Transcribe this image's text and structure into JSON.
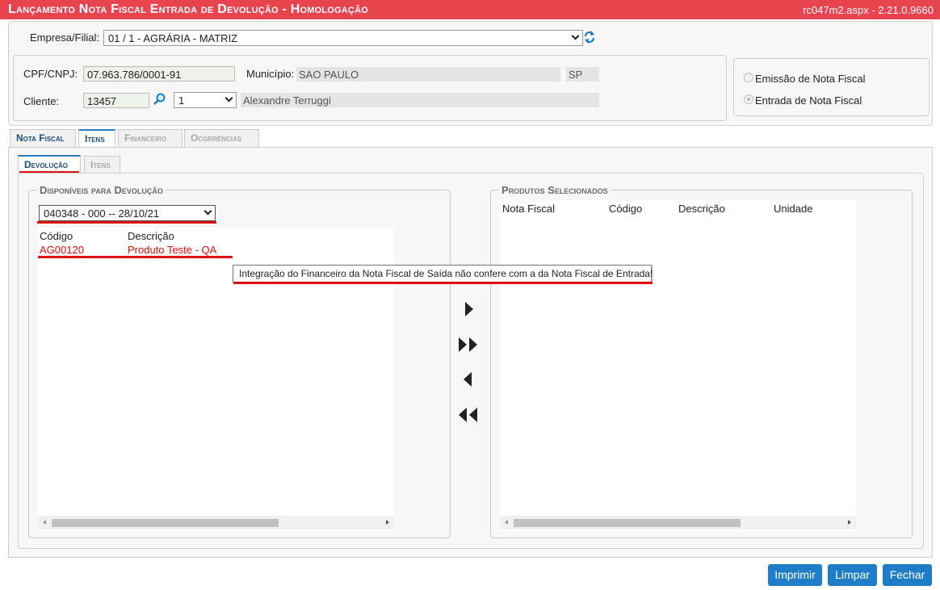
{
  "header": {
    "title": "Lançamento Nota Fiscal Entrada de Devolução  - Homologação",
    "version": "rc047m2.aspx - 2.21.0.9660"
  },
  "empresa": {
    "label": "Empresa/Filial:",
    "value": "01 / 1 - AGRÁRIA - MATRIZ"
  },
  "cliente_info": {
    "cpf_label": "CPF/CNPJ:",
    "cpf_value": "07.963.786/0001-91",
    "municipio_label": "Município:",
    "municipio_value": "SAO PAULO",
    "uf_value": "SP",
    "cliente_label": "Cliente:",
    "cliente_code": "13457",
    "cliente_seq": "1",
    "cliente_name": "Alexandre Terruggi"
  },
  "tipo": {
    "emissao": "Emissão de Nota Fiscal",
    "entrada": "Entrada de Nota Fiscal",
    "selected": "entrada"
  },
  "tabs": [
    "Nota Fiscal",
    "Itens",
    "Financeiro",
    "Ocorrências"
  ],
  "subtabs": [
    "Devolução",
    "Itens"
  ],
  "disponiveis": {
    "legend": "Disponíveis para Devolução",
    "select_value": "040348 - 000 -- 28/10/21",
    "columns": [
      "Código",
      "Descrição"
    ],
    "rows": [
      {
        "codigo": "AG00120",
        "descricao": "Produto Teste - QA"
      }
    ]
  },
  "tooltip": "Integração do Financeiro da Nota Fiscal de Saída não confere com a da Nota Fiscal de Entrada!",
  "selecionados": {
    "legend": "Produtos Selecionados",
    "columns": [
      "Nota Fiscal",
      "Código",
      "Descrição",
      "Unidade"
    ]
  },
  "buttons": {
    "imprimir": "Imprimir",
    "limpar": "Limpar",
    "fechar": "Fechar"
  },
  "colors": {
    "header_bg": "#e8434f",
    "button_bg": "#1f7cc7",
    "highlight": "#e01010",
    "tab_accent": "#2a7bc0"
  }
}
